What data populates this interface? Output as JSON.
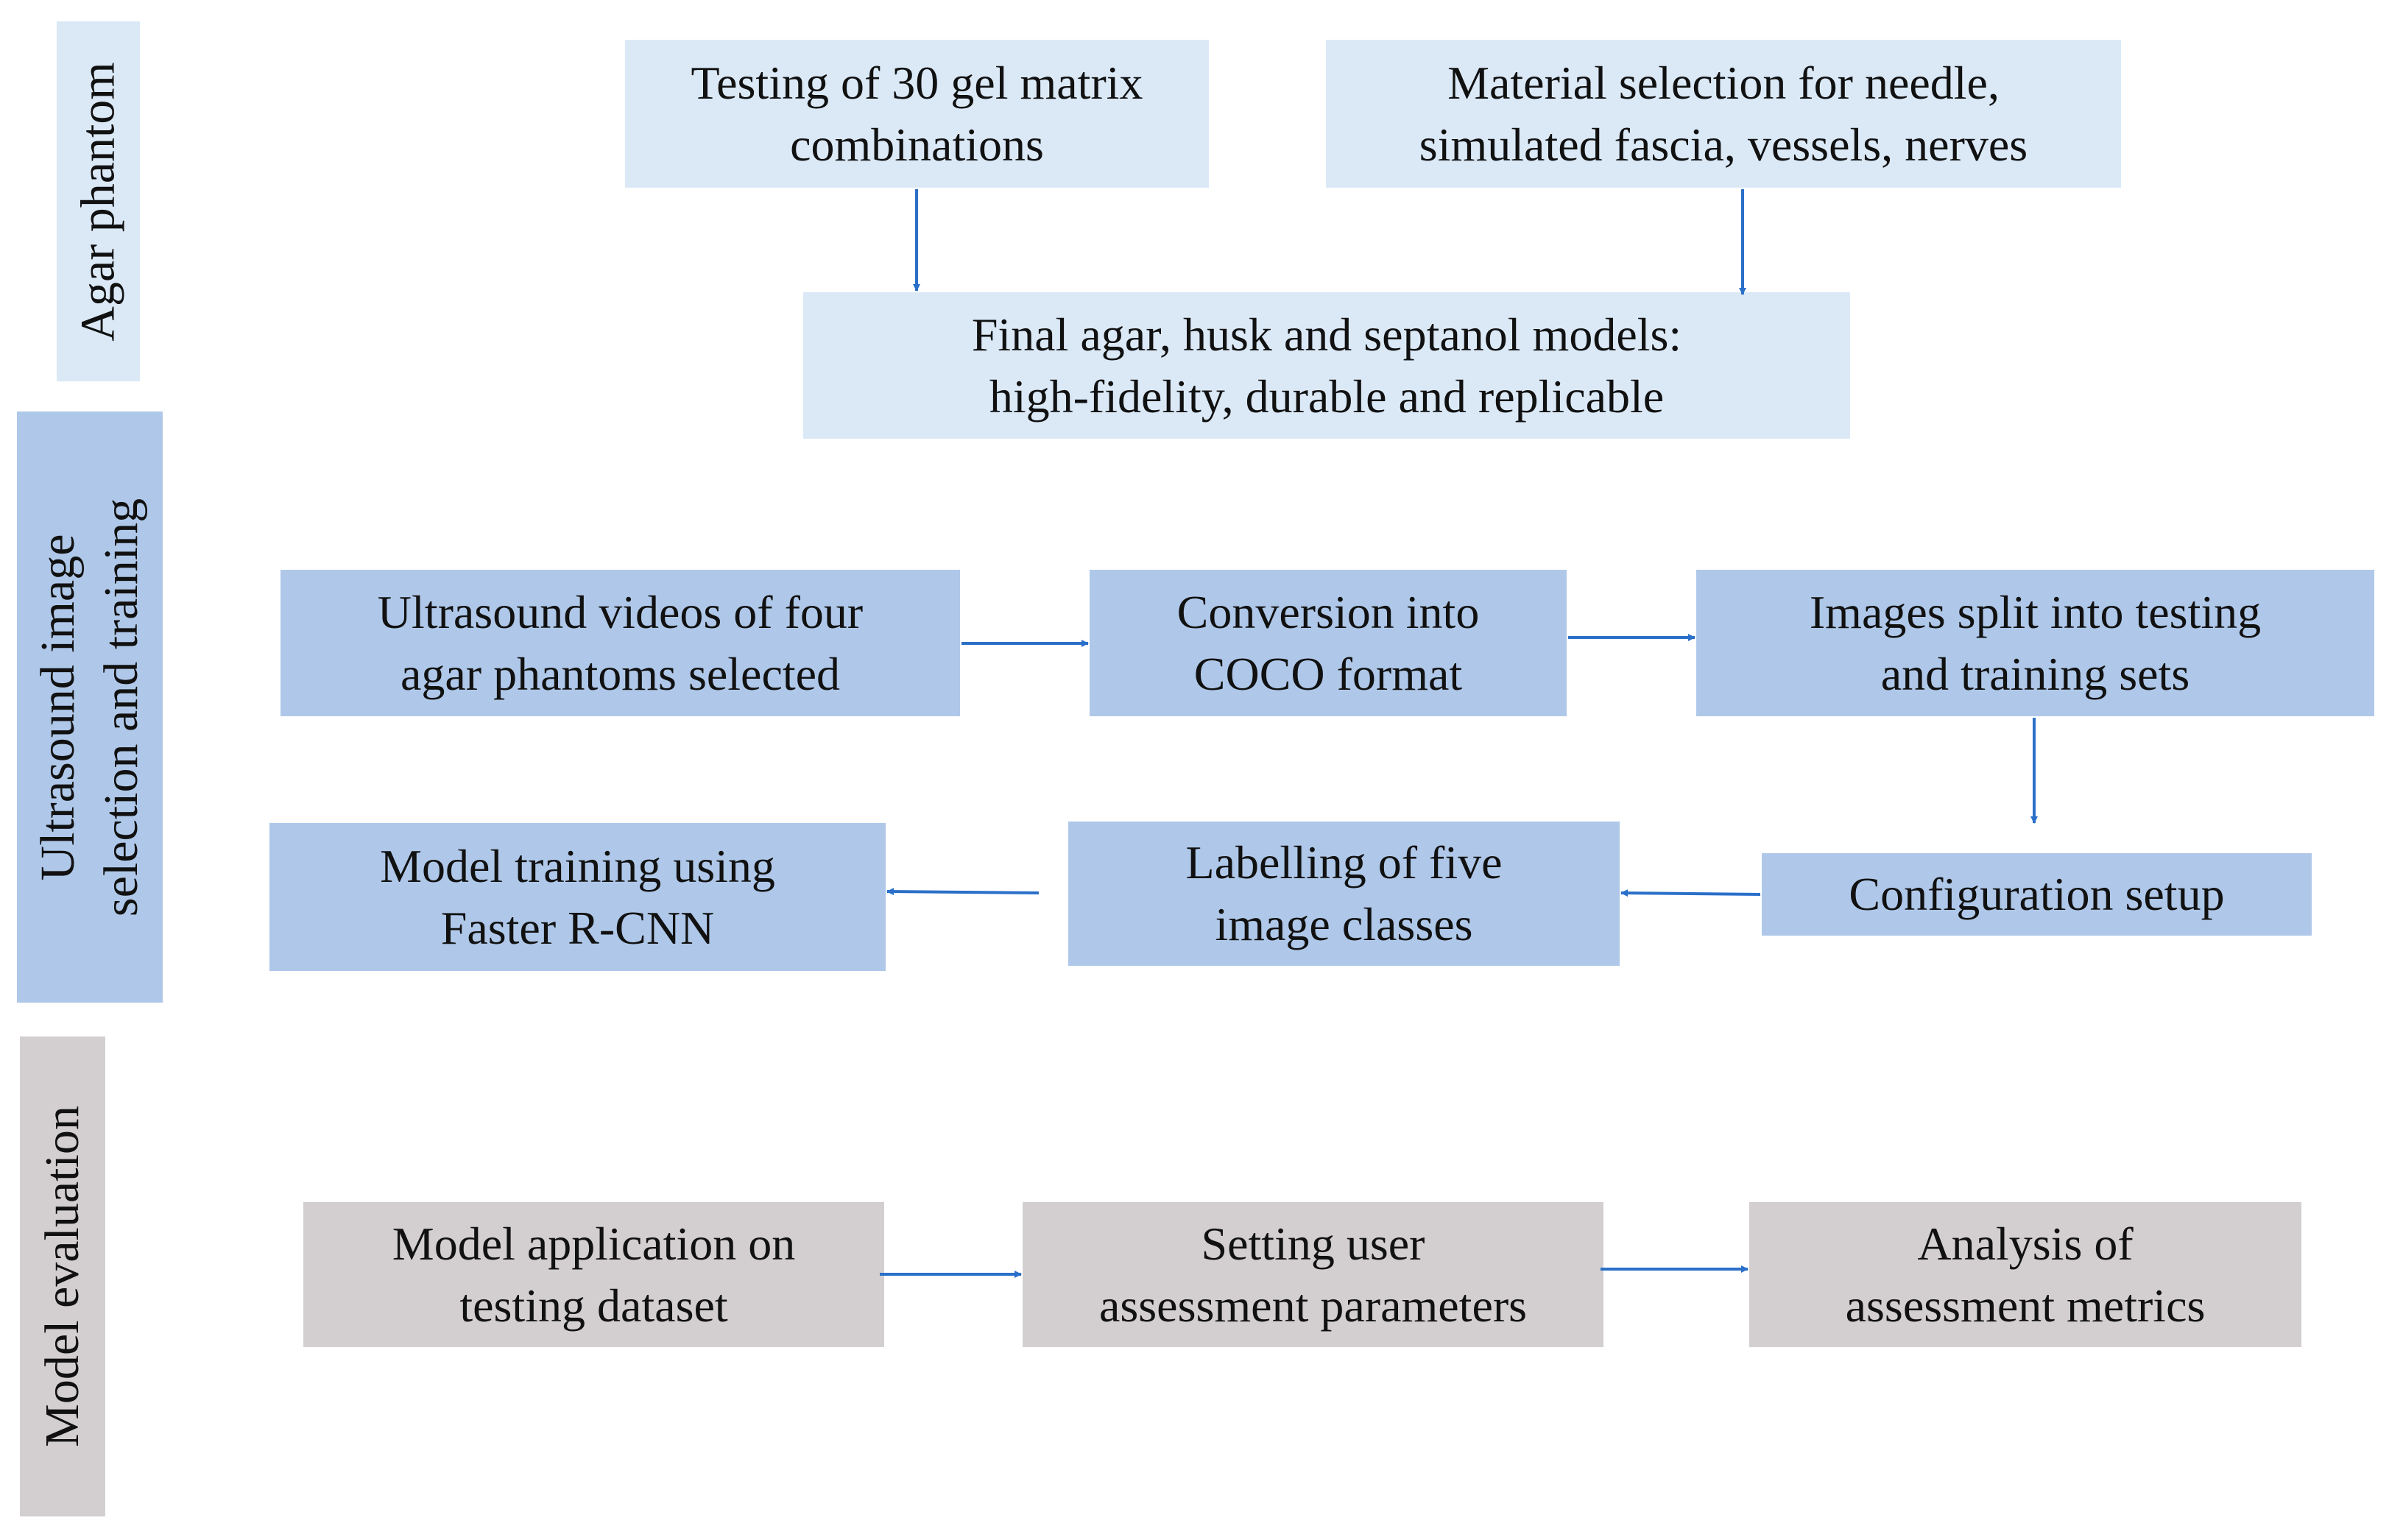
{
  "colors": {
    "phase1_fill": "#dbe9f7",
    "phase2_fill": "#afc8e9",
    "phase3_fill": "#d3cfd0",
    "arrow": "#2a6fc9"
  },
  "phases": [
    {
      "label": "Agar phantom"
    },
    {
      "label_line1": "Ultrasound image",
      "label_line2": "selection and training"
    },
    {
      "label": "Model evaluation"
    }
  ],
  "nodes": {
    "gel_testing": [
      "Testing of 30 gel matrix",
      "combinations"
    ],
    "material_selection": [
      "Material selection for needle,",
      "simulated fascia, vessels, nerves"
    ],
    "final_models": [
      "Final agar, husk and septanol models:",
      "high-fidelity, durable and replicable"
    ],
    "ultrasound_videos": [
      "Ultrasound videos of four",
      "agar phantoms selected"
    ],
    "coco_conversion": [
      "Conversion into",
      "COCO format"
    ],
    "images_split": [
      "Images split into testing",
      "and training sets"
    ],
    "configuration_setup": [
      "Configuration setup"
    ],
    "labelling": [
      "Labelling of five",
      "image classes"
    ],
    "model_training": [
      "Model training using",
      "Faster R-CNN"
    ],
    "model_application": [
      "Model application on",
      "testing dataset"
    ],
    "user_assessment": [
      "Setting user",
      "assessment parameters"
    ],
    "metrics_analysis": [
      "Analysis of",
      "assessment metrics"
    ]
  },
  "edges": [
    [
      "gel_testing",
      "final_models"
    ],
    [
      "material_selection",
      "final_models"
    ],
    [
      "ultrasound_videos",
      "coco_conversion"
    ],
    [
      "coco_conversion",
      "images_split"
    ],
    [
      "images_split",
      "configuration_setup"
    ],
    [
      "configuration_setup",
      "labelling"
    ],
    [
      "labelling",
      "model_training"
    ],
    [
      "model_application",
      "user_assessment"
    ],
    [
      "user_assessment",
      "metrics_analysis"
    ]
  ]
}
